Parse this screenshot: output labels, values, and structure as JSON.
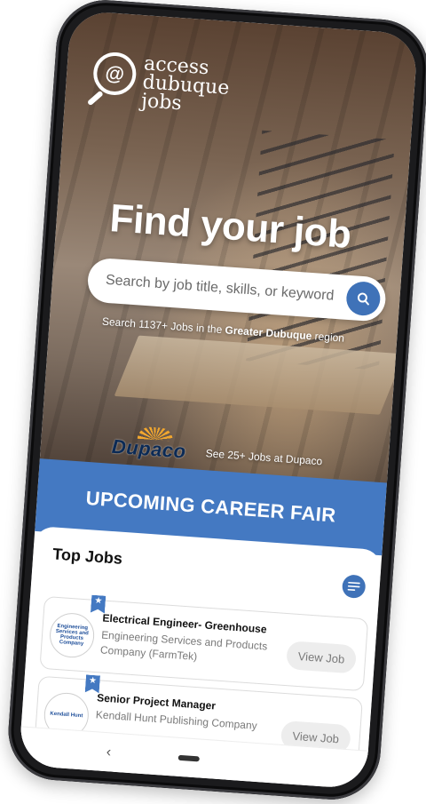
{
  "brand": {
    "line1": "access",
    "line2": "dubuque",
    "line3": "jobs",
    "mark": "@"
  },
  "hero": {
    "headline": "Find your job",
    "search_placeholder": "Search by job title, skills, or keyword",
    "count_prefix": "Search 1137+ Jobs in the ",
    "count_region": "Greater Dubuque",
    "count_suffix": " region"
  },
  "sponsor": {
    "name": "Dupaco",
    "link_text": "See 25+ Jobs at Dupaco"
  },
  "career_fair": {
    "title": "UPCOMING CAREER FAIR"
  },
  "top_jobs": {
    "title": "Top Jobs",
    "jobs": [
      {
        "title": "Electrical Engineer- Greenhouse",
        "company": "Engineering Services and Products Company (FarmTek)",
        "logo_text": "Engineering Services and Products Company",
        "action": "View Job"
      },
      {
        "title": "Senior Project Manager",
        "company": "Kendall Hunt Publishing Company",
        "logo_text": "Kendall Hunt",
        "action": "View Job"
      }
    ]
  },
  "nav": {
    "back_glyph": "‹"
  },
  "colors": {
    "accent": "#4479c2",
    "button": "#3f72b8",
    "sponsor_orange": "#f2a72e",
    "sponsor_navy": "#0b2a55"
  }
}
